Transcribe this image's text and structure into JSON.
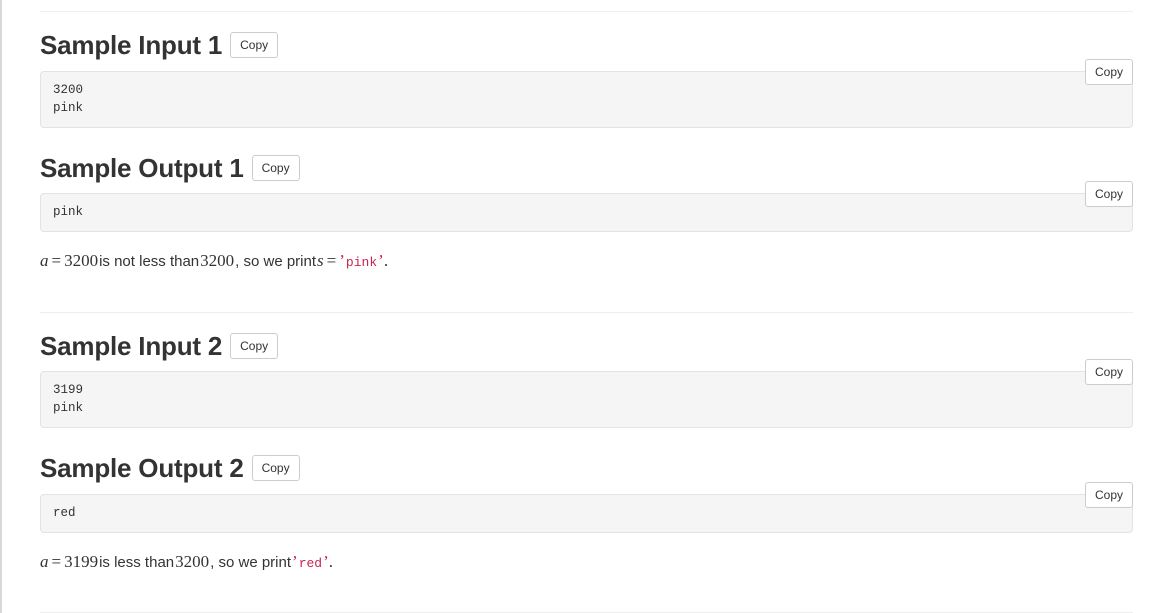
{
  "page": {
    "top_divider": true,
    "bottom_divider": true,
    "middle_divider": true
  },
  "copy_label": "Copy",
  "sections": [
    {
      "id": "sample-input-1",
      "heading": "Sample Input 1",
      "heading_copy_label": "Copy",
      "block_copy_label": "Copy",
      "code": "3200\npink",
      "explanation": null
    },
    {
      "id": "sample-output-1",
      "heading": "Sample Output 1",
      "heading_copy_label": "Copy",
      "block_copy_label": "Copy",
      "code": "pink",
      "explanation": {
        "var_a": "a",
        "eq1": "=",
        "value_a": "3200",
        "text_mid": "is not less than",
        "threshold": "3200",
        "text_tail": ", so we print",
        "var_s": "s",
        "eq2": "=",
        "quote_open": "’",
        "literal": "pink",
        "quote_close": "’",
        "period": "."
      }
    },
    {
      "id": "sample-input-2",
      "heading": "Sample Input 2",
      "heading_copy_label": "Copy",
      "block_copy_label": "Copy",
      "code": "3199\npink",
      "explanation": null
    },
    {
      "id": "sample-output-2",
      "heading": "Sample Output 2",
      "heading_copy_label": "Copy",
      "block_copy_label": "Copy",
      "code": "red",
      "explanation": {
        "var_a": "a",
        "eq1": "=",
        "value_a": "3199",
        "text_mid": "is less than",
        "threshold": "3200",
        "text_tail": ", so we print",
        "var_s": null,
        "eq2": null,
        "quote_open": "’",
        "literal": "red",
        "quote_close": "’",
        "period": "."
      }
    }
  ],
  "colors": {
    "code_literal": "#c7254e",
    "code_bg": "#f5f5f5",
    "code_border": "#e3e3e3",
    "divider": "#eeeeee",
    "heading_text": "#333333"
  }
}
